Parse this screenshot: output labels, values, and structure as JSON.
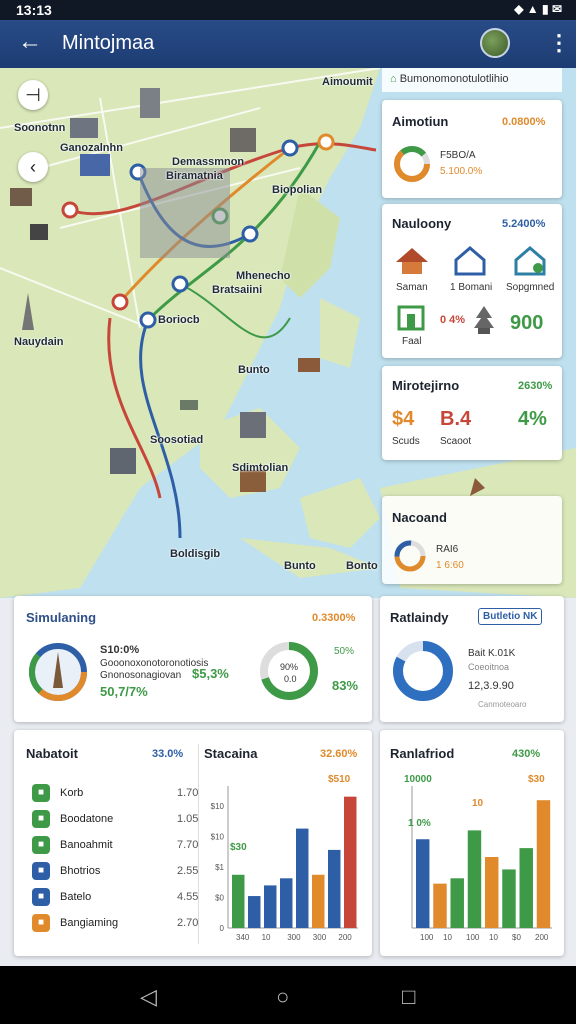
{
  "status_bar": {
    "time": "13:13",
    "icons": "◆ ▲ ▮ ✉"
  },
  "app_bar": {
    "back_icon": "arrow-left-icon",
    "title": "Mintojmaa",
    "more_icon": "more-vert-icon"
  },
  "map": {
    "labels": [
      "Aimoumit",
      "Soonotnn",
      "Ganozalnhn",
      "Demassmnon",
      "Biramatnia",
      "Biopolian",
      "Mhenecho",
      "Bratsaiini",
      "Nauydain",
      "Boriocb",
      "Bunto",
      "Soosotiad",
      "Sdimtolian",
      "Boldisgib",
      "Bunto",
      "Bonto"
    ],
    "top_strip": "Bumonomonotulotlihio",
    "colors": {
      "water": "#bfe0ee",
      "land": "#d9e7b9",
      "route_red": "#c6473a",
      "route_blue": "#2e5fa6",
      "route_orange": "#e08a2c",
      "route_green": "#3e9a47"
    }
  },
  "side_cards": {
    "aimnotiont": {
      "title": "Aimotiun",
      "value": "0.0800%",
      "sub1": "F5BO/A",
      "sub2": "5.100.0%"
    },
    "nauloony": {
      "title": "Nauloony",
      "value": "5.2400%",
      "items": [
        "Saman",
        "1 Bomani",
        "Sopgmned",
        "Faal",
        "0 4%",
        "900"
      ]
    },
    "mirotejirno": {
      "title": "Mirotejirno",
      "value": "2630%",
      "n1": "$4",
      "n2": "B.4",
      "n3": "4%",
      "l1": "Scuds",
      "l2": "Scaoot"
    },
    "nacoand": {
      "title": "Nacoand",
      "t1": "RAI6",
      "t2": "1 6:60"
    }
  },
  "bottom_cards": {
    "simulating": {
      "title": "Simulaning",
      "value": "0.3300%",
      "s1": "S10:0%",
      "s2": "Gooonoxonotoronotiosis",
      "s3": "Gnonosonagiovan",
      "s4": "50,7/7%",
      "s5": "$5,3%",
      "d1": "90%",
      "d2": "0.0",
      "d3": "50%",
      "d4": "83%"
    },
    "ranlaindy": {
      "title": "Ratlaindy",
      "badge": "Butletio NK",
      "l1": "Bait K.01K",
      "l2": "Coeoitnoa",
      "l3": "12,3.9.90",
      "l4": "Canmoteoaro"
    },
    "nabatoit": {
      "title": "Nabatoit",
      "value": "33.0%",
      "items": [
        {
          "label": "Korb",
          "value": "1.70",
          "color": "#3e9a47"
        },
        {
          "label": "Boodatone",
          "value": "1.05",
          "color": "#3e9a47"
        },
        {
          "label": "Banoahmit",
          "value": "7.70",
          "color": "#3e9a47"
        },
        {
          "label": "Bhotrios",
          "value": "2.55",
          "color": "#2e5fa6"
        },
        {
          "label": "Batelo",
          "value": "4.55",
          "color": "#2e5fa6"
        },
        {
          "label": "Bangiaming",
          "value": "2.70",
          "color": "#e08a2c"
        }
      ]
    },
    "stacaina": {
      "title": "Stacaina",
      "value": "32.60%"
    },
    "ranlafriod": {
      "title": "Ranlafriod",
      "value": "430%"
    }
  },
  "chart_data": [
    {
      "type": "bar",
      "title": "Stacaina",
      "x": [
        "340",
        "10",
        "300",
        "300",
        "200"
      ],
      "y_ticks": [
        "$10",
        "$10",
        "$1",
        "$0",
        "0"
      ],
      "annotations": [
        "$30",
        "$510"
      ],
      "values": [
        30,
        18,
        24,
        28,
        56,
        30,
        44,
        74
      ],
      "colors": [
        "#3e9a47",
        "#2e5fa6",
        "#2e5fa6",
        "#2e5fa6",
        "#2e5fa6",
        "#e08a2c",
        "#2e5fa6",
        "#c6473a"
      ],
      "ylim": [
        0,
        80
      ]
    },
    {
      "type": "bar",
      "title": "Ranlafriod",
      "x": [
        "100",
        "10",
        "100",
        "10",
        "$0",
        "200"
      ],
      "annotations": [
        "10000",
        "$30",
        "1 0%",
        "10"
      ],
      "values": [
        50,
        25,
        28,
        55,
        40,
        33,
        45,
        72
      ],
      "colors": [
        "#2e5fa6",
        "#e08a2c",
        "#3e9a47",
        "#3e9a47",
        "#e08a2c",
        "#3e9a47",
        "#3e9a47",
        "#e08a2c"
      ],
      "ylim": [
        0,
        80
      ]
    }
  ],
  "nav": {
    "back": "◁",
    "home": "○",
    "recent": "□"
  }
}
